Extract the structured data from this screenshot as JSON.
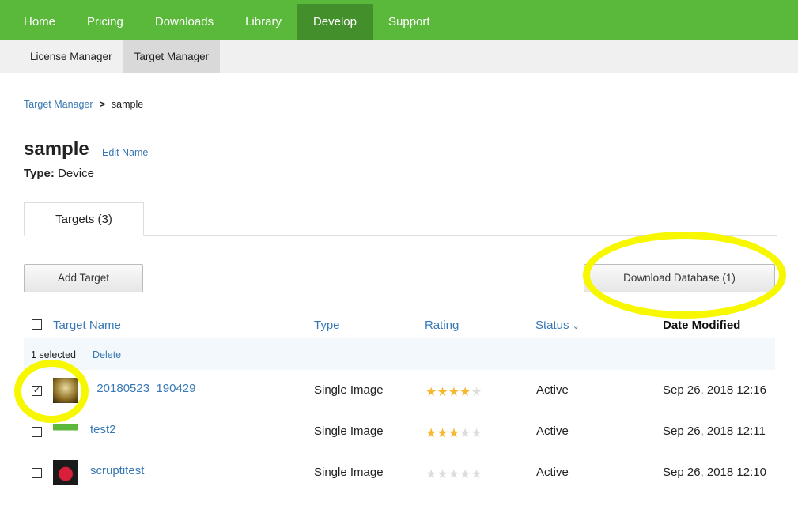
{
  "nav": {
    "items": [
      "Home",
      "Pricing",
      "Downloads",
      "Library",
      "Develop",
      "Support"
    ],
    "active": "Develop"
  },
  "subnav": {
    "items": [
      "License Manager",
      "Target Manager"
    ],
    "active": "Target Manager"
  },
  "breadcrumb": {
    "parent": "Target Manager",
    "current": "sample"
  },
  "database": {
    "name": "sample",
    "edit_label": "Edit Name",
    "type_label": "Type:",
    "type_value": "Device"
  },
  "tabs": {
    "targets": "Targets (3)"
  },
  "buttons": {
    "add": "Add Target",
    "download": "Download Database (1)"
  },
  "table": {
    "headers": {
      "name": "Target Name",
      "type": "Type",
      "rating": "Rating",
      "status": "Status",
      "date": "Date Modified"
    },
    "selection": {
      "count_text": "1 selected",
      "delete": "Delete"
    },
    "rows": [
      {
        "name": "_20180523_190429",
        "type": "Single Image",
        "rating": 4,
        "status": "Active",
        "date": "Sep 26, 2018 12:16",
        "checked": true
      },
      {
        "name": "test2",
        "type": "Single Image",
        "rating": 3,
        "status": "Active",
        "date": "Sep 26, 2018 12:11",
        "checked": false
      },
      {
        "name": "scruptitest",
        "type": "Single Image",
        "rating": 0,
        "status": "Active",
        "date": "Sep 26, 2018 12:10",
        "checked": false
      }
    ]
  },
  "colors": {
    "brand": "#5ab83b",
    "link": "#3878b4",
    "star": "#f5b82e",
    "highlight": "#f7f700"
  }
}
